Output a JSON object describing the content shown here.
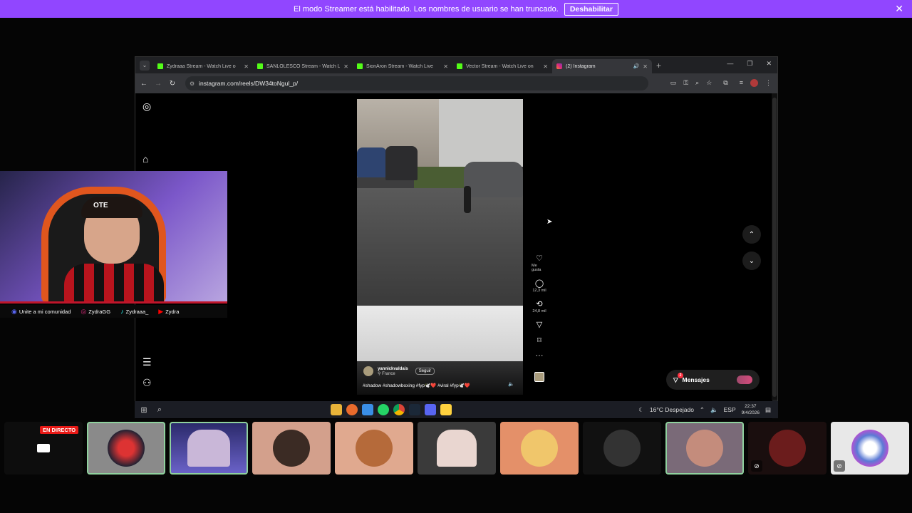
{
  "banner": {
    "message": "El modo Streamer está habilitado. Los nombres de usuario se han truncado.",
    "button": "Deshabilitar",
    "close": "✕"
  },
  "browser": {
    "tabs": [
      {
        "title": "Zydraaa Stream - Watch Live o",
        "icon": "kick-icon",
        "close": "✕"
      },
      {
        "title": "SANLOLESCO Stream - Watch L",
        "icon": "kick-icon",
        "close": "✕"
      },
      {
        "title": "SionAron Stream - Watch Live",
        "icon": "kick-icon",
        "close": "✕"
      },
      {
        "title": "Vector Stream - Watch Live on",
        "icon": "kick-icon",
        "close": "✕"
      },
      {
        "title": "(2) Instagram",
        "icon": "instagram-icon",
        "close": "✕",
        "active": true
      }
    ],
    "url": "instagram.com/reels/DW34toNgul_p/",
    "window_controls": [
      "—",
      "❐",
      "✕"
    ]
  },
  "instagram": {
    "reel": {
      "username": "yannickvaldais",
      "location": "France",
      "follow_label": "Seguir",
      "caption": "#shadow #shadowboxing #fyp🕊️❤️ #viral #fyp🕊️❤️"
    },
    "actions": {
      "like_label": "Me gusta",
      "comments": "12,3 mil",
      "reposts": "24,8 mil"
    },
    "messages_label": "Mensajes",
    "messages_badge": "2"
  },
  "taskbar": {
    "weather": "16°C Despejado",
    "lang": "ESP",
    "time": "22:37",
    "date": "9/4/2026"
  },
  "webcam": {
    "chair_text": "OTE",
    "socials": [
      {
        "icon": "discord-icon",
        "label": "Unite a mi comunidad"
      },
      {
        "icon": "instagram-icon",
        "label": "ZydraGG"
      },
      {
        "icon": "tiktok-icon",
        "label": "Zydraaa_"
      },
      {
        "icon": "youtube-icon",
        "label": "Zydra"
      }
    ]
  },
  "call": {
    "live_badge": "EN DIRECTO"
  },
  "colors": {
    "banner": "#9146ff",
    "kick_green": "#53fc18",
    "live_red": "#e91916"
  }
}
